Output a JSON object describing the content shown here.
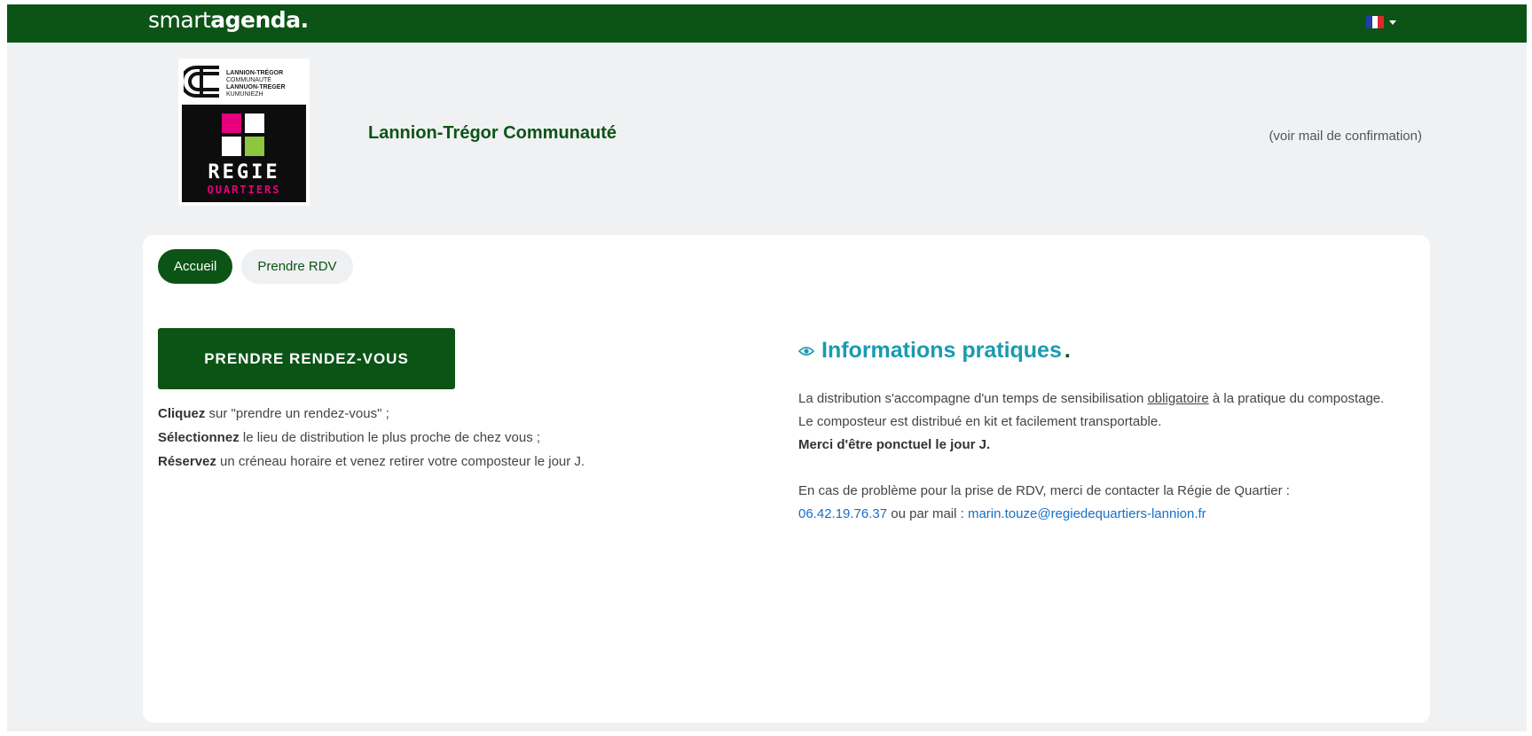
{
  "header": {
    "brand_light": "smart",
    "brand_bold": "agenda.",
    "language_flag_colors": [
      "#1f3fa6",
      "#ffffff",
      "#e1262d"
    ],
    "language_icon": "france-flag-icon"
  },
  "logo": {
    "line1": "LANNION-TRÉGOR",
    "line2": "COMMUNAUTÉ",
    "line3": "LANNUON-TREGER",
    "line4": "KUMUNIEZH",
    "regie": "REGIE",
    "quartiers": "QUARTIERS"
  },
  "organization": {
    "name": "Lannion-Trégor Communauté",
    "confirmation_note": "(voir mail de confirmation)"
  },
  "tabs": [
    {
      "label": "Accueil",
      "active": true
    },
    {
      "label": "Prendre RDV",
      "active": false
    }
  ],
  "main": {
    "cta_label": "PRENDRE RENDEZ-VOUS",
    "steps": [
      {
        "bold": "Cliquez",
        "text": " sur \"prendre un rendez-vous\" ;"
      },
      {
        "bold": "Sélectionnez",
        "text": " le lieu de distribution le plus proche de chez vous ;"
      },
      {
        "bold": "Réservez",
        "text": " un créneau horaire et venez retirer votre composteur le jour J."
      }
    ]
  },
  "info": {
    "title": "Informations pratiques",
    "title_dot": ".",
    "icon": "eye-icon",
    "p1_before": "La distribution s'accompagne d'un temps de sensibilisation ",
    "p1_underline": "obligatoire",
    "p1_after": " à la pratique du compostage. Le composteur est distribué en kit et facilement transportable.",
    "p1_bold": "Merci d'être ponctuel le jour J.",
    "p2_text": "En cas de problème pour la prise de RDV, merci de contacter la Régie de Quartier :",
    "phone": "06.42.19.76.37",
    "mail_prefix": " ou par mail : ",
    "email": "marin.touze@regiedequartiers-lannion.fr"
  },
  "colors": {
    "brand_green": "#0b5416",
    "title_teal": "#1a9bb0",
    "link_blue": "#1670c9"
  }
}
